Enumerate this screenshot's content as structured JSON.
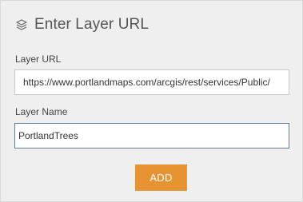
{
  "header": {
    "title": "Enter Layer URL",
    "icon": "layers-icon"
  },
  "layer_url": {
    "label": "Layer URL",
    "value": "https://www.portlandmaps.com/arcgis/rest/services/Public/"
  },
  "layer_name": {
    "label": "Layer Name",
    "value": "PortlandTrees"
  },
  "actions": {
    "add_label": "ADD"
  },
  "colors": {
    "accent": "#e89332",
    "panel_bg": "#efefef",
    "focus_border": "#5a7fa8"
  }
}
